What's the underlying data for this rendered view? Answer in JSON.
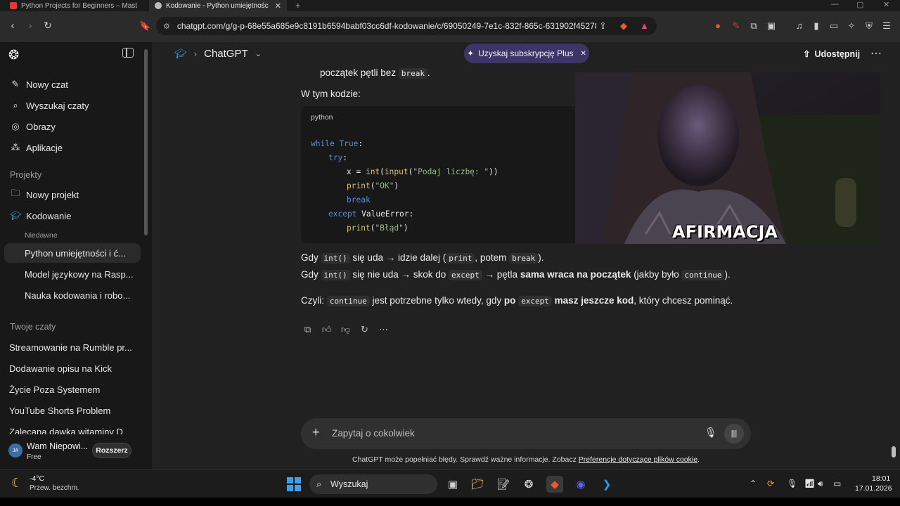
{
  "browser": {
    "tabs": [
      {
        "title": "Python Projects for Beginners – Mast",
        "color": "#e53935"
      },
      {
        "title": "Kodowanie - Python umiejętnośc",
        "color": "#bdbdbd"
      }
    ],
    "url": "chatgpt.com/g/g-p-68e55a685e9c8191b6594babf03cc6df-kodowanie/c/69050249-7e1c-832f-865c-631902f45278"
  },
  "sidebar": {
    "top_items": [
      {
        "label": "Nowy czat",
        "icon": "compose-icon"
      },
      {
        "label": "Wyszukaj czaty",
        "icon": "search-icon"
      },
      {
        "label": "Obrazy",
        "icon": "images-icon"
      },
      {
        "label": "Aplikacje",
        "icon": "apps-icon"
      }
    ],
    "projects_heading": "Projekty",
    "project_items": [
      {
        "label": "Nowy projekt",
        "icon": "new-folder-icon"
      },
      {
        "label": "Kodowanie",
        "icon": "graduation-cap-icon"
      }
    ],
    "recent_label": "Niedawne",
    "recent_items": [
      {
        "label": "Python umiejętności i ć..."
      },
      {
        "label": "Model językowy na Rasp..."
      },
      {
        "label": "Nauka kodowania i robo..."
      }
    ],
    "chats_heading": "Twoje czaty",
    "chat_items": [
      {
        "label": "Streamowanie na Rumble pr..."
      },
      {
        "label": "Dodawanie opisu na Kick"
      },
      {
        "label": "Życie Poza Systemem"
      },
      {
        "label": "YouTube Shorts Problem"
      },
      {
        "label": "Zalecana dawka witaminy D"
      }
    ],
    "user": {
      "initials": "JA",
      "name": "Wam Niepowi...",
      "plan": "Free",
      "upgrade_label": "Rozszerz"
    }
  },
  "header": {
    "model": "ChatGPT",
    "plus_pill": "Uzyskaj subskrypcję Plus",
    "share": "Udostępnij"
  },
  "message": {
    "top_tail_a": "początek pętli bez",
    "top_tail_code": "break",
    "intro": "W tym kodzie:",
    "code_lang": "python",
    "line1_a": "Gdy",
    "line1_code1": "int()",
    "line1_b": "się uda → idzie dalej (",
    "line1_code2": "print",
    "line1_c": ", potem",
    "line1_code3": "break",
    "line1_d": ").",
    "line2_a": "Gdy",
    "line2_code1": "int()",
    "line2_b": "się nie uda → skok do",
    "line2_code2": "except",
    "line2_c": "→ pętla",
    "line2_bold": "sama wraca na początek",
    "line2_d": "(jakby było",
    "line2_code3": "continue",
    "line2_e": ").",
    "line3_a": "Czyli:",
    "line3_code1": "continue",
    "line3_b": "jest potrzebne tylko wtedy, gdy",
    "line3_bold1": "po",
    "line3_code2": "except",
    "line3_bold2": "masz jeszcze kod",
    "line3_c": ", który chcesz pominąć."
  },
  "code": {
    "l1_kw": "while",
    "l1_true": "True",
    "l1_colon": ":",
    "l2_kw": "try",
    "l2_colon": ":",
    "l3_x": "x = ",
    "l3_int": "int",
    "l3_p1": "(",
    "l3_input": "input",
    "l3_p2": "(",
    "l3_str": "\"Podaj liczbę: \"",
    "l3_p3": "))",
    "l4_print": "print",
    "l4_p1": "(",
    "l4_str": "\"OK\"",
    "l4_p2": ")",
    "l5_kw": "break",
    "l6_kw": "except",
    "l6_err": " ValueError:",
    "l7_print": "print",
    "l7_p1": "(",
    "l7_str": "\"Błąd\"",
    "l7_p2": ")"
  },
  "webcam": {
    "overlay_text": "AFIRMACJA"
  },
  "composer": {
    "placeholder": "Zapytaj o cokolwiek"
  },
  "disclaimer": {
    "text": "ChatGPT może popełniać błędy. Sprawdź ważne informacje. Zobacz",
    "link": "Preferencje dotyczące plików cookie",
    "end": "."
  },
  "taskbar": {
    "weather_temp": "-4°C",
    "weather_desc": "Przew. bezchm.",
    "search": "Wyszukaj",
    "time": "18:01",
    "date": "17.01.2026"
  },
  "colors": {
    "accent_purple": "#3c3566",
    "code_keyword": "#5c8de8",
    "code_string": "#8ec07c",
    "code_function": "#d9c36b"
  }
}
